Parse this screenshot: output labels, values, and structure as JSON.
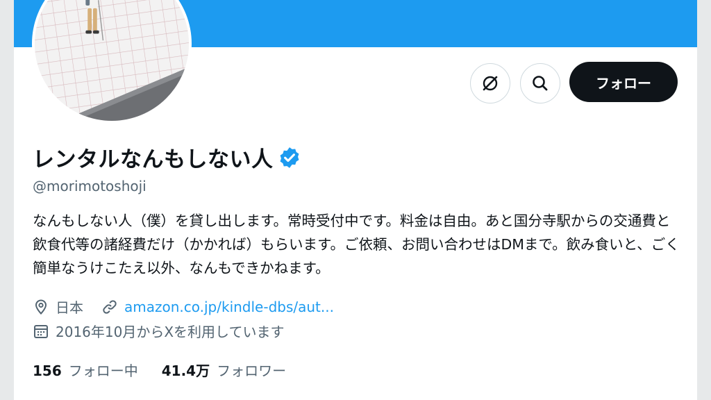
{
  "profile": {
    "display_name": "レンタルなんもしない人",
    "handle": "@morimotoshoji",
    "bio": "なんもしない人（僕）を貸し出します。常時受付中です。料金は自由。あと国分寺駅からの交通費と飲食代等の諸経費だけ（かかれば）もらいます。ご依頼、お問い合わせはDMまで。飲み食いと、ごく簡単なうけこたえ以外、なんもできかねます。",
    "location": "日本",
    "website": "amazon.co.jp/kindle-dbs/aut...",
    "joined": "2016年10月からXを利用しています"
  },
  "actions": {
    "follow_label": "フォロー",
    "grok_icon": "grok-icon",
    "search_icon": "search-icon"
  },
  "stats": {
    "following_count": "156",
    "following_label": "フォロー中",
    "followers_count": "41.4万",
    "followers_label": "フォロワー"
  },
  "colors": {
    "banner": "#1d9bf0",
    "accent": "#1d9bf0",
    "follow_button": "#0f1419",
    "secondary_text": "#536471"
  }
}
